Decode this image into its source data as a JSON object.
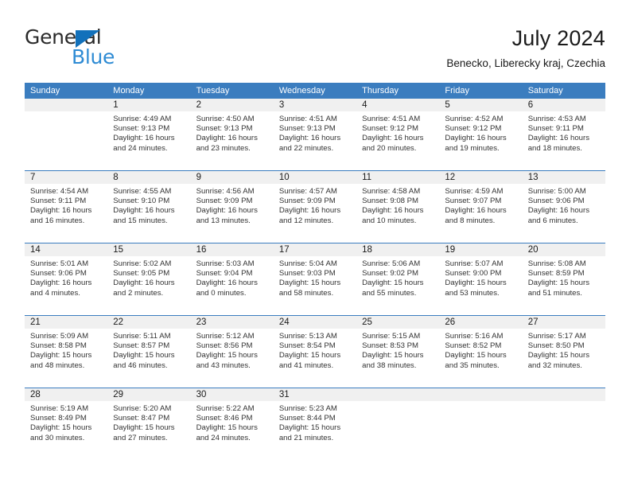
{
  "brand": {
    "name_top": "General",
    "name_bottom": "Blue",
    "flag_color": "#1271bb",
    "blue_color": "#2e8bd4"
  },
  "header": {
    "title": "July 2024",
    "subtitle": "Benecko, Liberecky kraj, Czechia"
  },
  "theme": {
    "header_bg": "#3b7dbf",
    "daynum_bg": "#f0f0f0",
    "grid_line": "#3b7dbf"
  },
  "weekdays": [
    "Sunday",
    "Monday",
    "Tuesday",
    "Wednesday",
    "Thursday",
    "Friday",
    "Saturday"
  ],
  "weeks": [
    [
      {
        "day": "",
        "info": ""
      },
      {
        "day": "1",
        "info": "Sunrise: 4:49 AM\nSunset: 9:13 PM\nDaylight: 16 hours\nand 24 minutes."
      },
      {
        "day": "2",
        "info": "Sunrise: 4:50 AM\nSunset: 9:13 PM\nDaylight: 16 hours\nand 23 minutes."
      },
      {
        "day": "3",
        "info": "Sunrise: 4:51 AM\nSunset: 9:13 PM\nDaylight: 16 hours\nand 22 minutes."
      },
      {
        "day": "4",
        "info": "Sunrise: 4:51 AM\nSunset: 9:12 PM\nDaylight: 16 hours\nand 20 minutes."
      },
      {
        "day": "5",
        "info": "Sunrise: 4:52 AM\nSunset: 9:12 PM\nDaylight: 16 hours\nand 19 minutes."
      },
      {
        "day": "6",
        "info": "Sunrise: 4:53 AM\nSunset: 9:11 PM\nDaylight: 16 hours\nand 18 minutes."
      }
    ],
    [
      {
        "day": "7",
        "info": "Sunrise: 4:54 AM\nSunset: 9:11 PM\nDaylight: 16 hours\nand 16 minutes."
      },
      {
        "day": "8",
        "info": "Sunrise: 4:55 AM\nSunset: 9:10 PM\nDaylight: 16 hours\nand 15 minutes."
      },
      {
        "day": "9",
        "info": "Sunrise: 4:56 AM\nSunset: 9:09 PM\nDaylight: 16 hours\nand 13 minutes."
      },
      {
        "day": "10",
        "info": "Sunrise: 4:57 AM\nSunset: 9:09 PM\nDaylight: 16 hours\nand 12 minutes."
      },
      {
        "day": "11",
        "info": "Sunrise: 4:58 AM\nSunset: 9:08 PM\nDaylight: 16 hours\nand 10 minutes."
      },
      {
        "day": "12",
        "info": "Sunrise: 4:59 AM\nSunset: 9:07 PM\nDaylight: 16 hours\nand 8 minutes."
      },
      {
        "day": "13",
        "info": "Sunrise: 5:00 AM\nSunset: 9:06 PM\nDaylight: 16 hours\nand 6 minutes."
      }
    ],
    [
      {
        "day": "14",
        "info": "Sunrise: 5:01 AM\nSunset: 9:06 PM\nDaylight: 16 hours\nand 4 minutes."
      },
      {
        "day": "15",
        "info": "Sunrise: 5:02 AM\nSunset: 9:05 PM\nDaylight: 16 hours\nand 2 minutes."
      },
      {
        "day": "16",
        "info": "Sunrise: 5:03 AM\nSunset: 9:04 PM\nDaylight: 16 hours\nand 0 minutes."
      },
      {
        "day": "17",
        "info": "Sunrise: 5:04 AM\nSunset: 9:03 PM\nDaylight: 15 hours\nand 58 minutes."
      },
      {
        "day": "18",
        "info": "Sunrise: 5:06 AM\nSunset: 9:02 PM\nDaylight: 15 hours\nand 55 minutes."
      },
      {
        "day": "19",
        "info": "Sunrise: 5:07 AM\nSunset: 9:00 PM\nDaylight: 15 hours\nand 53 minutes."
      },
      {
        "day": "20",
        "info": "Sunrise: 5:08 AM\nSunset: 8:59 PM\nDaylight: 15 hours\nand 51 minutes."
      }
    ],
    [
      {
        "day": "21",
        "info": "Sunrise: 5:09 AM\nSunset: 8:58 PM\nDaylight: 15 hours\nand 48 minutes."
      },
      {
        "day": "22",
        "info": "Sunrise: 5:11 AM\nSunset: 8:57 PM\nDaylight: 15 hours\nand 46 minutes."
      },
      {
        "day": "23",
        "info": "Sunrise: 5:12 AM\nSunset: 8:56 PM\nDaylight: 15 hours\nand 43 minutes."
      },
      {
        "day": "24",
        "info": "Sunrise: 5:13 AM\nSunset: 8:54 PM\nDaylight: 15 hours\nand 41 minutes."
      },
      {
        "day": "25",
        "info": "Sunrise: 5:15 AM\nSunset: 8:53 PM\nDaylight: 15 hours\nand 38 minutes."
      },
      {
        "day": "26",
        "info": "Sunrise: 5:16 AM\nSunset: 8:52 PM\nDaylight: 15 hours\nand 35 minutes."
      },
      {
        "day": "27",
        "info": "Sunrise: 5:17 AM\nSunset: 8:50 PM\nDaylight: 15 hours\nand 32 minutes."
      }
    ],
    [
      {
        "day": "28",
        "info": "Sunrise: 5:19 AM\nSunset: 8:49 PM\nDaylight: 15 hours\nand 30 minutes."
      },
      {
        "day": "29",
        "info": "Sunrise: 5:20 AM\nSunset: 8:47 PM\nDaylight: 15 hours\nand 27 minutes."
      },
      {
        "day": "30",
        "info": "Sunrise: 5:22 AM\nSunset: 8:46 PM\nDaylight: 15 hours\nand 24 minutes."
      },
      {
        "day": "31",
        "info": "Sunrise: 5:23 AM\nSunset: 8:44 PM\nDaylight: 15 hours\nand 21 minutes."
      },
      {
        "day": "",
        "info": ""
      },
      {
        "day": "",
        "info": ""
      },
      {
        "day": "",
        "info": ""
      }
    ]
  ]
}
